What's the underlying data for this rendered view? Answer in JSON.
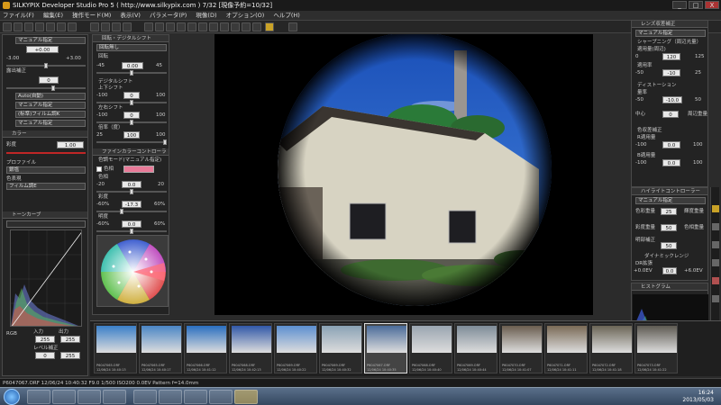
{
  "window": {
    "title": "SILKYPIX Developer Studio Pro 5 ( http://www.silkypix.com )   7/32 [現像予約=10/32]",
    "minimize": "_",
    "maximize": "□",
    "close": "X"
  },
  "menu": [
    "ファイル(F)",
    "編集(E)",
    "操作モード(M)",
    "表示(V)",
    "パラメータ(P)",
    "現像(D)",
    "オプション(O)",
    "ヘルプ(H)"
  ],
  "left_panel": {
    "preset": "マニュアル指定",
    "exposure_value": "+0.00",
    "minus_label": "-3.00",
    "plus_label": "+3.00",
    "section_label": "露出補正",
    "wb_value": "0",
    "wb_mode": "Auto(自動)",
    "tone": "マニュアル指定",
    "film": "(标準)フィルム調K",
    "color_mode": "マニュアル指定",
    "color_header": "カラー",
    "saturation_label": "彩度",
    "saturation_value": "1.00",
    "profile_label": "プロファイル",
    "profile_value": "銀塩",
    "color_palette_label": "色表現",
    "color_palette_value": "フィルム調E",
    "curve_header": "トーンカーブ",
    "curve_channel": "RGB",
    "input_label": "入力",
    "output_label": "出力",
    "input_value": "255",
    "output_value": "255",
    "level_label": "レベル補正",
    "level_low": "0",
    "level_high": "255"
  },
  "mid_panel": {
    "rotation_header": "回転・デジタルシフト",
    "rotation_preset": "回転無し",
    "rotate_label": "回転",
    "rotate_min": "-45",
    "rotate_value": "0.00",
    "rotate_max": "45",
    "digital_shift_label": "デジタルシフト",
    "up_label": "上下シフト",
    "up_min": "-100",
    "up_value": "0",
    "up_max": "100",
    "lr_label": "左右シフト",
    "lr_min": "-100",
    "lr_value": "0",
    "lr_max": "100",
    "scale_label": "倍率（度）",
    "scale_min": "25",
    "scale_value": "100",
    "scale_max": "100",
    "fine_header": "ファインカラーコントローラー",
    "fine_mode": "色調モード(マニュアル指定)",
    "hue_label": "色相",
    "hue_min": "-20",
    "hue_value": "0.0",
    "hue_max": "20",
    "sat_label": "彩度",
    "sat_min": "-60%",
    "sat_value": "-17.3",
    "sat_max": "60%",
    "lum_label": "明度",
    "lum_min": "-60%",
    "lum_value": "0.0",
    "lum_max": "60%",
    "swatch_color": "#e87a98"
  },
  "right_panel": {
    "lens_header": "レンズ収差補正",
    "lens_preset": "マニュアル指定",
    "sharp_label": "シャープニング（周辺光量）",
    "sharp_amount_label": "適用量(周辺)",
    "sharp_min": "0",
    "sharp_value": "120",
    "sharp_max": "125",
    "sharp2_label": "適用率",
    "sharp2_min": "-50",
    "sharp2_value": "-10",
    "sharp2_max": "25",
    "distortion_label": "ディストーション",
    "dist_sub": "量率",
    "dist_min": "-50",
    "dist_value": "-10.0",
    "dist_max": "50",
    "center_label": "中心",
    "center_value": "0",
    "center_right": "周辺重量",
    "chroma_label": "色収差補正",
    "red_label": "R適用量",
    "red_min": "-100",
    "red_value": "0.0",
    "red_max": "100",
    "blue_label": "B適用量",
    "blue_min": "-100",
    "blue_value": "0.0",
    "blue_max": "100",
    "hl_header": "ハイライトコントローラー",
    "hl_preset": "マニュアル指定",
    "hl1_label": "色彩重量",
    "hl1_value": "25",
    "hl1_right": "輝度重量",
    "hl2_label": "彩度重量",
    "hl2_value": "50",
    "hl2_right": "色相重量",
    "hl3_label": "明部補正",
    "hl3_value": "50",
    "dr_label": "ダイナミックレンジ",
    "dr_sub": "DR拡張",
    "dr_min": "+0.0EV",
    "dr_value": "0.0",
    "dr_max": "+6.0EV",
    "histogram_header": "ヒストグラム"
  },
  "thumbnails": [
    {
      "name": "P6047065.ORF",
      "info": "12/06/24 10:40:13",
      "color": "#3a7fc8"
    },
    {
      "name": "P6047065.ORF",
      "info": "12/06/24 10:40:17",
      "color": "#4a86c5"
    },
    {
      "name": "P6047066.ORF",
      "info": "12/06/24 10:41:12",
      "color": "#2a6fc0"
    },
    {
      "name": "P6047068.ORF",
      "info": "12/06/24 10:42:13",
      "color": "#3158a8"
    },
    {
      "name": "P6047069.ORF",
      "info": "12/06/24 10:40:22",
      "color": "#5c8fd0"
    },
    {
      "name": "P6047069.ORF",
      "info": "12/06/24 10:40:32",
      "color": "#8aa2b5"
    },
    {
      "name": "P6047067.ORF",
      "info": "12/06/24 10:40:35",
      "color": "#4b6c9a"
    },
    {
      "name": "P6047068.ORF",
      "info": "12/06/24 10:40:40",
      "color": "#9aa5b0"
    },
    {
      "name": "P6047069.ORF",
      "info": "12/06/24 10:40:44",
      "color": "#7e8c98"
    },
    {
      "name": "P6047070.ORF",
      "info": "12/06/24 10:41:07",
      "color": "#6a5d4f"
    },
    {
      "name": "P6047071.ORF",
      "info": "12/06/24 10:41:11",
      "color": "#7a6a56"
    },
    {
      "name": "P6047072.ORF",
      "info": "12/06/24 10:41:18",
      "color": "#6b6556"
    },
    {
      "name": "P6047073.ORF",
      "info": "12/06/24 10:41:22",
      "color": "#5e5a52"
    }
  ],
  "status": "P6047067.ORF 12/06/24 10:40:32 F9.0 1/500 ISO200 0.0EV Pattern f=14.0mm",
  "taskbar": {
    "time": "16:24",
    "date": "2013/05/03"
  }
}
